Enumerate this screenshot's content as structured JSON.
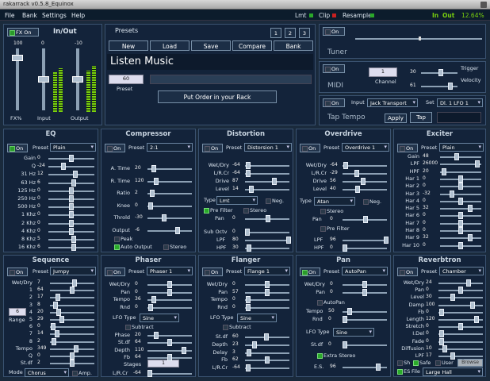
{
  "window_title": "rakarrack  v0.5.8_Equinox",
  "menu": [
    "File",
    "Bank",
    "Settings",
    "Help"
  ],
  "indicators": {
    "lmt": "Lmt",
    "clip": "Clip",
    "resample": "Resample",
    "in_label": "In",
    "out_label": "Out",
    "cpu": "12.64%"
  },
  "io": {
    "title": "In/Out",
    "fx_on": "FX On",
    "fx_pct": "FX%",
    "input": "Input",
    "output": "Output",
    "scale_top": "100",
    "scale_mid": "0",
    "out_top": "-10"
  },
  "presets": {
    "title": "Presets",
    "num1": "1",
    "num2": "2",
    "num3": "3",
    "new": "New",
    "load": "Load",
    "save": "Save",
    "compare": "Compare",
    "bank": "Bank",
    "name": "Listen Music",
    "preset_num": "60",
    "preset_label": "Preset",
    "put_order": "Put Order in your Rack"
  },
  "tuner": {
    "on": "On",
    "title": "Tuner"
  },
  "midi": {
    "on": "On",
    "title": "MIDI",
    "channel": "1",
    "channel_label": "Channel",
    "trigger": "Trigger",
    "velocity": "Velocity",
    "trig_val": "30",
    "vel_val": "61"
  },
  "taptempo": {
    "on": "On",
    "title": "Tap Tempo",
    "input_label": "Input",
    "input_val": "Jack Transport",
    "set_label": "Set",
    "set_val": "Dl. 1 LFO 1",
    "apply": "Apply",
    "tap": "Tap"
  },
  "colors": {
    "bg": "#1a2a3c",
    "panel": "#13233a",
    "led_green": "#2a9a2a",
    "meter": "#7ad10e"
  },
  "eq": {
    "title": "EQ",
    "on": "On",
    "preset_label": "Preset",
    "preset": "Plain",
    "rows": [
      {
        "l": "Gain",
        "v": "0",
        "p": 0.5
      },
      {
        "l": "Q",
        "v": "-24",
        "p": 0.3
      },
      {
        "l": "31 Hz",
        "v": "12",
        "p": 0.6
      },
      {
        "l": "63 Hz",
        "v": "6",
        "p": 0.55
      },
      {
        "l": "125 Hz",
        "v": "0",
        "p": 0.5
      },
      {
        "l": "250 Hz",
        "v": "0",
        "p": 0.5
      },
      {
        "l": "500 Hz",
        "v": "0",
        "p": 0.5
      },
      {
        "l": "1 Khz",
        "v": "0",
        "p": 0.5
      },
      {
        "l": "2 Khz",
        "v": "0",
        "p": 0.5
      },
      {
        "l": "4 Khz",
        "v": "0",
        "p": 0.5
      },
      {
        "l": "8 Khz",
        "v": "5",
        "p": 0.55
      },
      {
        "l": "16 Khz",
        "v": "6",
        "p": 0.55
      }
    ]
  },
  "compressor": {
    "title": "Compressor",
    "on": "On",
    "preset_label": "Preset",
    "preset": "2:1",
    "rows": [
      {
        "l": "A. Time",
        "v": "20",
        "p": 0.1
      },
      {
        "l": "R. Time",
        "v": "120",
        "p": 0.15
      },
      {
        "l": "Ratio",
        "v": "2",
        "p": 0.05
      },
      {
        "l": "Knee",
        "v": "0",
        "p": 0.02
      },
      {
        "l": "Throld",
        "v": "-30",
        "p": 0.35
      },
      {
        "l": "Output",
        "v": "-6",
        "p": 0.7
      }
    ],
    "peak": "Peak",
    "auto": "Auto Output",
    "stereo": "Stereo"
  },
  "distortion": {
    "title": "Distortion",
    "on": "On",
    "preset_label": "Preset",
    "preset": "Distorsion 1",
    "rows": [
      {
        "l": "Wet/Dry",
        "v": "-64",
        "p": 0.02
      },
      {
        "l": "L/R.Cr",
        "v": "-64",
        "p": 0.02
      },
      {
        "l": "Drive",
        "v": "87",
        "p": 0.68
      },
      {
        "l": "Level",
        "v": "14",
        "p": 0.1
      }
    ],
    "type_label": "Type",
    "type": "Lmt",
    "neg": "Neg.",
    "prefilter": "Pre Filter",
    "stereo": "Stereo",
    "pan_l": "Pan",
    "pan_v": "0",
    "suboct_l": "Sub Octv",
    "suboct_v": "0",
    "lpf_l": "LPF",
    "lpf_v": "80",
    "hpf_l": "HPF",
    "hpf_v": "30"
  },
  "overdrive": {
    "title": "Overdrive",
    "on": "On",
    "preset_label": "Preset",
    "preset": "Overdrive 1",
    "rows": [
      {
        "l": "Wet/Dry",
        "v": "-64",
        "p": 0.02
      },
      {
        "l": "L/R.Cr",
        "v": "-29",
        "p": 0.3
      },
      {
        "l": "Drive",
        "v": "56",
        "p": 0.45
      },
      {
        "l": "Level",
        "v": "40",
        "p": 0.32
      }
    ],
    "type_label": "Type",
    "type": "Atan",
    "neg": "Neg.",
    "stereo": "Stereo",
    "pan_l": "Pan",
    "pan_v": "0",
    "prefilter": "Pre Filter",
    "lpf_l": "LPF",
    "lpf_v": "96",
    "hpf_l": "HPF",
    "hpf_v": "0"
  },
  "exciter": {
    "title": "Exciter",
    "on": "On",
    "preset_label": "Preset",
    "preset": "Plain",
    "rows": [
      {
        "l": "Gain",
        "v": "48",
        "p": 0.4
      },
      {
        "l": "LPF",
        "v": "26000",
        "p": 0.95
      },
      {
        "l": "HPF",
        "v": "20",
        "p": 0.05
      },
      {
        "l": "Har 1",
        "v": "0",
        "p": 0.5
      },
      {
        "l": "Har 2",
        "v": "0",
        "p": 0.5
      },
      {
        "l": "Har 3",
        "v": "-32",
        "p": 0.25
      },
      {
        "l": "Har 4",
        "v": "0",
        "p": 0.5
      },
      {
        "l": "Har 5",
        "v": "32",
        "p": 0.75
      },
      {
        "l": "Har 6",
        "v": "0",
        "p": 0.5
      },
      {
        "l": "Har 7",
        "v": "0",
        "p": 0.5
      },
      {
        "l": "Har 8",
        "v": "0",
        "p": 0.5
      },
      {
        "l": "Har 9",
        "v": "32",
        "p": 0.75
      },
      {
        "l": "Har 10",
        "v": "0",
        "p": 0.5
      }
    ]
  },
  "sequence": {
    "title": "Sequence",
    "on": "On",
    "preset_label": "Preset",
    "preset": "Jumpy",
    "rows": [
      {
        "l": "Wet/Dry",
        "v": "7",
        "p": 0.55
      },
      {
        "l": "1",
        "v": "64",
        "p": 0.5
      },
      {
        "l": "2",
        "v": "17",
        "p": 0.14
      },
      {
        "l": "3",
        "v": "8",
        "p": 0.07
      },
      {
        "l": "4",
        "v": "20",
        "p": 0.16
      },
      {
        "l": "5",
        "v": "29",
        "p": 0.23
      },
      {
        "l": "6",
        "v": "0",
        "p": 0.02
      },
      {
        "l": "7",
        "v": "14",
        "p": 0.11
      },
      {
        "l": "8",
        "v": "2",
        "p": 0.03
      },
      {
        "l": "Tempo",
        "v": "349",
        "p": 0.6
      },
      {
        "l": "Q",
        "v": "0",
        "p": 0.5
      },
      {
        "l": "St.df",
        "v": "2",
        "p": 0.5
      }
    ],
    "range_label": "Range",
    "range": "6",
    "mode_label": "Mode",
    "mode": "Chorus",
    "amp": "Amp."
  },
  "phaser": {
    "title": "Phaser",
    "on": "On",
    "preset_label": "Preset",
    "preset": "Phaser 1",
    "rows": [
      {
        "l": "Wet/Dry",
        "v": "0",
        "p": 0.5
      },
      {
        "l": "Pan",
        "v": "0",
        "p": 0.5
      },
      {
        "l": "Tempo",
        "v": "36",
        "p": 0.1
      },
      {
        "l": "Rnd",
        "v": "0",
        "p": 0.02
      }
    ],
    "lfo_label": "LFO Type",
    "lfo": "Sine",
    "subtract": "Subtract",
    "rows2": [
      {
        "l": "Phase",
        "v": "20",
        "p": 0.16
      },
      {
        "l": "St.df",
        "v": "64",
        "p": 0.5
      },
      {
        "l": "Depth",
        "v": "110",
        "p": 0.86
      },
      {
        "l": "Fb",
        "v": "64",
        "p": 0.5
      }
    ],
    "stages_label": "Stages",
    "stages": "1",
    "lr_l": "L/R.Cr",
    "lr_v": "-64"
  },
  "flanger": {
    "title": "Flanger",
    "on": "On",
    "preset_label": "Preset",
    "preset": "Flange 1",
    "rows": [
      {
        "l": "Wet/Dry",
        "v": "0",
        "p": 0.5
      },
      {
        "l": "Pan",
        "v": "57",
        "p": 0.5
      },
      {
        "l": "Tempo",
        "v": "0",
        "p": 0.02
      },
      {
        "l": "Rnd",
        "v": "0",
        "p": 0.02
      }
    ],
    "lfo_label": "LFO Type",
    "lfo": "Sine",
    "subtract": "Subtract",
    "rows2": [
      {
        "l": "St.df",
        "v": "60",
        "p": 0.47
      },
      {
        "l": "Depth",
        "v": "23",
        "p": 0.18
      },
      {
        "l": "Delay",
        "v": "3",
        "p": 0.03
      },
      {
        "l": "Fb",
        "v": "62",
        "p": 0.5
      },
      {
        "l": "L/R.Cr",
        "v": "-64",
        "p": 0.02
      }
    ]
  },
  "pan": {
    "title": "Pan",
    "on": "On",
    "preset_label": "Preset",
    "preset": "AutoPan",
    "rows": [
      {
        "l": "Wet/Dry",
        "v": "0",
        "p": 0.5
      },
      {
        "l": "Pan",
        "v": "0",
        "p": 0.5
      }
    ],
    "autopan": "AutoPan",
    "tempo_l": "Tempo",
    "tempo_v": "50",
    "rnd_l": "Rnd",
    "rnd_v": "0",
    "lfo_label": "LFO Type",
    "lfo": "Sine",
    "stdf_l": "St.df",
    "stdf_v": "0",
    "extra": "Extra Stereo",
    "es_l": "E.S.",
    "es_v": "96"
  },
  "reverbtron": {
    "title": "Reverbtron",
    "on": "On",
    "preset_label": "Preset",
    "preset": "Chamber",
    "rows": [
      {
        "l": "Wet/Dry",
        "v": "24",
        "p": 0.7
      },
      {
        "l": "Pan",
        "v": "0",
        "p": 0.5
      },
      {
        "l": "Level",
        "v": "30",
        "p": 0.3
      },
      {
        "l": "Damp",
        "v": "100",
        "p": 0.8
      },
      {
        "l": "Fb",
        "v": "0",
        "p": 0.02
      },
      {
        "l": "Length",
        "v": "120",
        "p": 0.9
      },
      {
        "l": "Stretch",
        "v": "0",
        "p": 0.5
      },
      {
        "l": "I.Del",
        "v": "0",
        "p": 0.02
      },
      {
        "l": "Fade",
        "v": "0",
        "p": 0.02
      },
      {
        "l": "Diffusion",
        "v": "10",
        "p": 0.1
      },
      {
        "l": "LPF",
        "v": "17",
        "p": 0.3
      }
    ],
    "sh": "Sh",
    "safe": "Safe",
    "user": "User",
    "es": "ES",
    "file_label": "File",
    "file": "Large Hall",
    "browse": "Browse"
  }
}
